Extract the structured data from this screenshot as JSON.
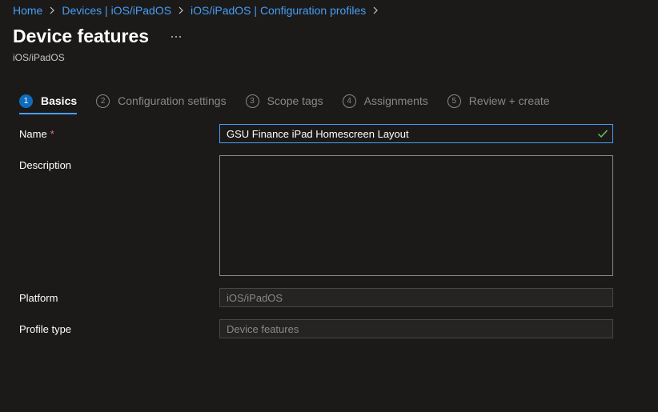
{
  "breadcrumb": {
    "items": [
      "Home",
      "Devices | iOS/iPadOS",
      "iOS/iPadOS | Configuration profiles"
    ]
  },
  "header": {
    "title": "Device features",
    "more_label": "...",
    "subtitle": "iOS/iPadOS"
  },
  "steps": [
    {
      "number": "1",
      "label": "Basics",
      "active": true
    },
    {
      "number": "2",
      "label": "Configuration settings",
      "active": false
    },
    {
      "number": "3",
      "label": "Scope tags",
      "active": false
    },
    {
      "number": "4",
      "label": "Assignments",
      "active": false
    },
    {
      "number": "5",
      "label": "Review + create",
      "active": false
    }
  ],
  "form": {
    "name": {
      "label": "Name",
      "required_marker": "*",
      "value": "GSU Finance iPad Homescreen Layout",
      "valid": true
    },
    "description": {
      "label": "Description",
      "value": ""
    },
    "platform": {
      "label": "Platform",
      "value": "iOS/iPadOS"
    },
    "profile_type": {
      "label": "Profile type",
      "value": "Device features"
    }
  },
  "icons": {
    "breadcrumb_separator": "chevron-right-icon",
    "more": "ellipsis-icon",
    "valid": "checkmark-icon"
  },
  "colors": {
    "background": "#1b1a19",
    "link": "#479ef5",
    "accent": "#0f6cbd",
    "required": "#f1707b",
    "valid": "#6ccb5f"
  }
}
